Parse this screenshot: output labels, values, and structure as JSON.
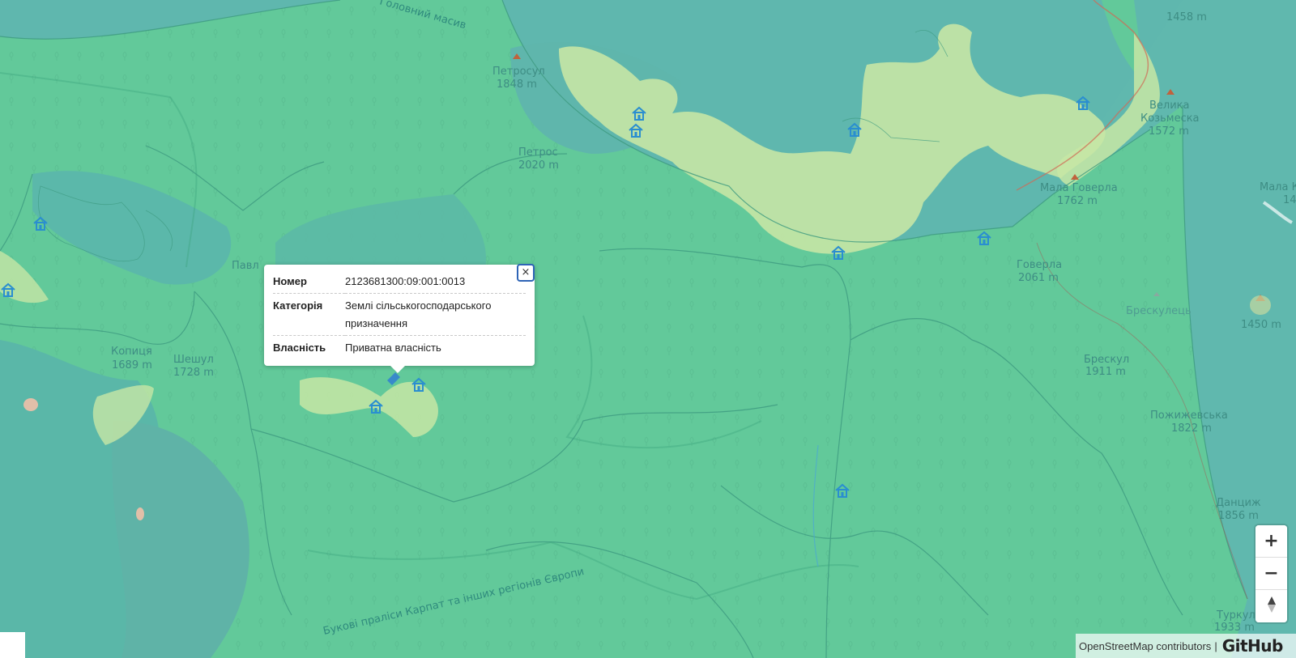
{
  "map": {
    "labels": {
      "massif": "Головний масив",
      "petros_name": "Петрос",
      "petros_elev": "2020 m",
      "petrosul_name": "Петросул",
      "petrosul_elev": "1848 m",
      "peak1458": "1458 m",
      "velyka_line1": "Велика",
      "velyka_line2": "Козьмеска",
      "velyka_elev": "1572 m",
      "mala_hoverla_name": "Мала Говерла",
      "mala_hoverla_elev": "1762 m",
      "hoverla_name": "Говерла",
      "hoverla_elev": "2061 m",
      "breskulets": "Брескулець",
      "peak1450": "1450 m",
      "breskul_name": "Брескул",
      "breskul_elev": "1911 m",
      "pozhyzhevska_name": "Пожижевська",
      "pozhyzhevska_elev": "1822 m",
      "danchyzh_name": "Данциж",
      "danchyzh_elev": "1856 m",
      "turkul_name": "Туркул",
      "turkul_elev": "1933 m",
      "mala_k": "Мала К",
      "mala_k_elev": "14",
      "kopytsia_name": "Копиця",
      "kopytsia_elev": "1689 m",
      "sheshul_name": "Шешул",
      "sheshul_elev": "1728 m",
      "pavl": "Павл",
      "beech_forests": "Букові праліси Карпат та інших регіонів Європи"
    },
    "icons": [
      "house-icon",
      "house-icon",
      "house-icon",
      "house-icon",
      "house-icon",
      "house-icon",
      "house-icon",
      "house-icon",
      "house-icon",
      "house-icon",
      "house-icon"
    ],
    "colors": {
      "reserve": "#62c99a",
      "forest_dark": "#5fb7ae",
      "agri": "#c6e5a4",
      "boundary": "#3d9a80",
      "icon": "#2a8ed0"
    }
  },
  "popup": {
    "rows": [
      {
        "key": "Номер",
        "value": "2123681300:09:001:0013"
      },
      {
        "key": "Категорія",
        "value": "Землі сільськогосподарського призначення"
      },
      {
        "key": "Власність",
        "value": "Приватна власність"
      }
    ],
    "close_label": "×"
  },
  "controls": {
    "zoom_in": "+",
    "zoom_out": "−",
    "reset_north": "▲"
  },
  "attribution": {
    "osm": "OpenStreetMap contributors",
    "separator": "|",
    "github": "GitHub"
  }
}
